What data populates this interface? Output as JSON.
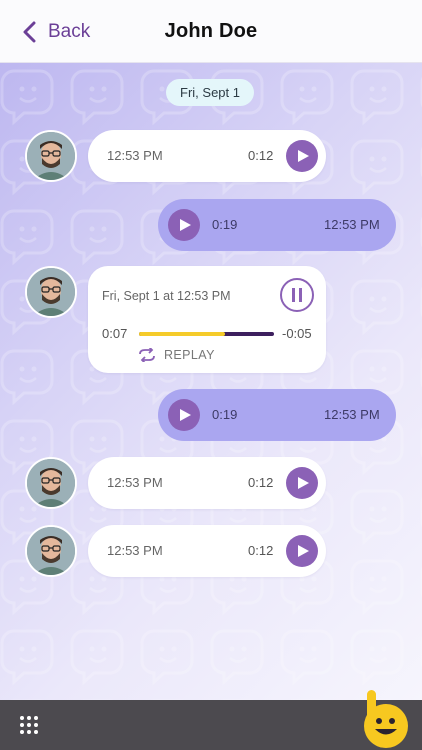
{
  "header": {
    "back_label": "Back",
    "title": "John Doe"
  },
  "chat": {
    "date_divider": "Fri, Sept 1",
    "messages": [
      {
        "direction": "incoming",
        "time": "12:53 PM",
        "duration": "0:12"
      },
      {
        "direction": "outgoing",
        "time": "12:53 PM",
        "duration": "0:19"
      },
      {
        "direction": "incoming",
        "state": "playing",
        "datetime": "Fri, Sept 1 at 12:53 PM",
        "elapsed": "0:07",
        "remaining": "-0:05",
        "progress_fraction": 0.64,
        "replay_label": "REPLAY"
      },
      {
        "direction": "outgoing",
        "time": "12:53 PM",
        "duration": "0:19"
      },
      {
        "direction": "incoming",
        "time": "12:53 PM",
        "duration": "0:12"
      },
      {
        "direction": "incoming",
        "time": "12:53 PM",
        "duration": "0:12"
      }
    ]
  },
  "icons": {
    "back": "chevron-left-icon",
    "play": "play-icon",
    "pause": "pause-icon",
    "replay": "replay-icon",
    "grid": "grid-menu-icon",
    "mascot": "smiley-mascot-icon"
  },
  "colors": {
    "accent": "#6b3f97",
    "play_button": "#8b61b6",
    "outgoing_bubble": "#aaa6f0",
    "progress_played": "#f5cb2a",
    "progress_remaining": "#3d1f5e",
    "date_pill": "#e4f6fa",
    "footer": "#4c4a4f",
    "mascot": "#f7c820"
  }
}
